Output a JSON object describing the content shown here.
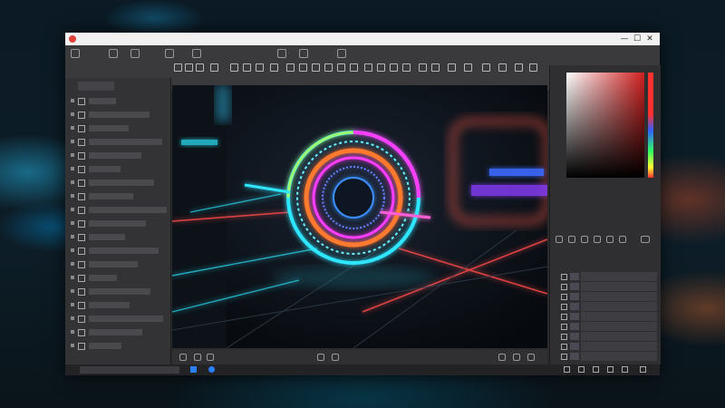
{
  "window": {
    "title": "",
    "controls": {
      "minimize": "—",
      "maximize": "☐",
      "close": "✕"
    }
  },
  "toolbar": {
    "row1_icons": [
      "undo-icon",
      "redo-icon",
      "brush-icon",
      "gear-icon",
      "move-icon",
      "lasso-icon",
      "pen-icon",
      "crop-icon"
    ],
    "row2_icons": [
      "select-icon",
      "shape-icon",
      "paint-icon",
      "fill-icon",
      "eraser-icon",
      "text-icon",
      "zoom-icon",
      "hand-icon"
    ]
  },
  "left_panel": {
    "tab_label": "",
    "rows": [
      "",
      "",
      "",
      "",
      "",
      "",
      "",
      "",
      "",
      "",
      "",
      "",
      "",
      "",
      "",
      "",
      "",
      "",
      ""
    ]
  },
  "canvas": {
    "image": "neon-ring-render",
    "colors": {
      "cyan": "#2ee6ff",
      "magenta": "#ff3cff",
      "orange": "#ff7a2e",
      "blue": "#3a6bff"
    }
  },
  "right_panel": {
    "color_picker": {
      "base": "#d02020"
    },
    "layers": [
      "",
      "",
      "",
      "",
      "",
      "",
      "",
      "",
      ""
    ]
  },
  "taskbar": {
    "search_placeholder": ""
  }
}
